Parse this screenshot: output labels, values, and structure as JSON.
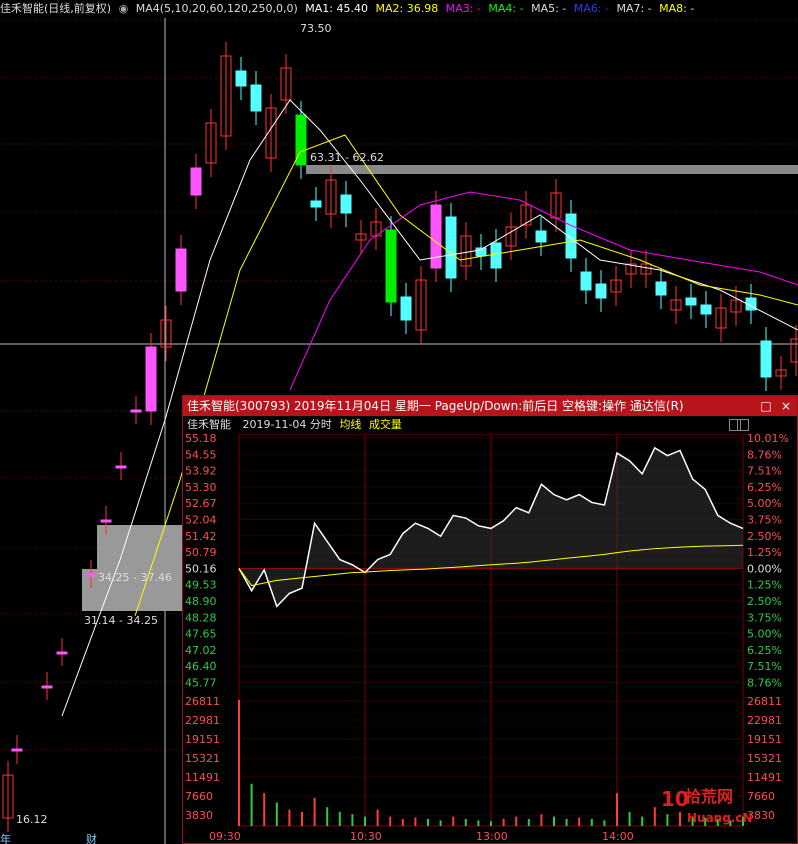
{
  "header": {
    "stock": "佳禾智能(日线,前复权)",
    "ma4": "MA4(5,10,20,60,120,250,0,0)",
    "ma1": "MA1: 45.40",
    "ma2": "MA2: 36.98",
    "ma3": "MA3: -",
    "ma4v": "MA4: -",
    "ma5": "MA5: -",
    "ma6": "MA6: -",
    "ma7": "MA7: -",
    "ma8": "MA8: -"
  },
  "colors": {
    "ma1": "#ffffff",
    "ma2": "#ffff00",
    "ma3": "#ff00ff",
    "ma4": "#00ff00",
    "ma5": "#ffffff",
    "ma6": "#0000ff",
    "ma7": "#ffffff",
    "ma8": "#ffff00",
    "up": "#ff3333",
    "down": "#55ffff",
    "limit_up": "#ff55ff",
    "limit_dn": "#00ee00",
    "popup_title": "#b8141b"
  },
  "daily": {
    "high_label": "73.50",
    "low_label": "16.12",
    "range_label_1": "63.31 - 62.62",
    "range_label_2": "34.25 - 37.46",
    "range_label_3": "31.14 - 34.25",
    "bottom_left_1": "年",
    "bottom_left_2": "财"
  },
  "popup": {
    "title": "佳禾智能(300793) 2019年11月04日 星期一 PageUp/Down:前后日 空格键:操作 通达信(R)",
    "btn_restore": "□",
    "btn_close": "×",
    "sub_name": "佳禾智能",
    "sub_date": "2019-11-04 分时",
    "sub_avg": "均线",
    "sub_vol": "成交量",
    "price_labels": [
      "55.18",
      "54.55",
      "53.92",
      "53.30",
      "52.67",
      "52.04",
      "51.42",
      "50.79",
      "50.16",
      "49.53",
      "48.90",
      "48.28",
      "47.65",
      "47.02",
      "46.40",
      "45.77"
    ],
    "pct_labels": [
      "10.01%",
      "8.76%",
      "7.51%",
      "6.25%",
      "5.00%",
      "3.75%",
      "2.50%",
      "1.25%",
      "0.00%",
      "1.25%",
      "2.50%",
      "3.75%",
      "5.00%",
      "6.25%",
      "7.51%",
      "8.76%"
    ],
    "vol_labels": [
      "26811",
      "22981",
      "19151",
      "15321",
      "11491",
      "7660",
      "3830"
    ],
    "time_labels": [
      "09:30",
      "10:30",
      "13:00",
      "14:00"
    ],
    "prev_close": "50.16",
    "watermark": "拾荒网",
    "watermark_sub": "Huang.cN",
    "watermark_logo": "10"
  },
  "chart_data": {
    "type": "line",
    "title": "佳禾智能 2019-11-04 分时",
    "series": [
      {
        "name": "分时",
        "values": [
          50.16,
          49.3,
          50.1,
          48.7,
          49.2,
          49.4,
          51.9,
          51.2,
          50.5,
          50.3,
          50.0,
          50.5,
          50.7,
          51.5,
          51.9,
          51.7,
          51.4,
          52.2,
          52.1,
          51.8,
          51.7,
          52.0,
          52.5,
          52.3,
          53.4,
          53.0,
          52.8,
          53.0,
          52.7,
          52.6,
          54.6,
          54.3,
          53.8,
          54.8,
          54.5,
          54.7,
          53.6,
          53.2,
          52.2,
          51.9,
          51.7
        ]
      },
      {
        "name": "均线",
        "values": [
          50.16,
          49.5,
          49.6,
          49.7,
          49.75,
          49.8,
          49.85,
          49.9,
          49.95,
          50.0,
          50.02,
          50.05,
          50.08,
          50.1,
          50.12,
          50.14,
          50.17,
          50.2,
          50.23,
          50.27,
          50.3,
          50.33,
          50.36,
          50.4,
          50.45,
          50.5,
          50.55,
          50.6,
          50.65,
          50.7,
          50.77,
          50.83,
          50.88,
          50.92,
          50.95,
          50.98,
          51.0,
          51.02,
          51.03,
          51.04,
          51.05
        ]
      }
    ],
    "ylim": [
      45.77,
      55.18
    ],
    "volume": [
      26811,
      9000,
      7000,
      5000,
      3500,
      3000,
      6000,
      4000,
      3000,
      2500,
      2000,
      3500,
      2000,
      1500,
      1800,
      1500,
      1200,
      2000,
      1500,
      1200,
      1000,
      1500,
      2000,
      1500,
      2500,
      2000,
      1500,
      1800,
      1500,
      1200,
      7000,
      3000,
      2000,
      4000,
      2500,
      3000,
      2000,
      1800,
      1500,
      1200,
      2000
    ]
  }
}
